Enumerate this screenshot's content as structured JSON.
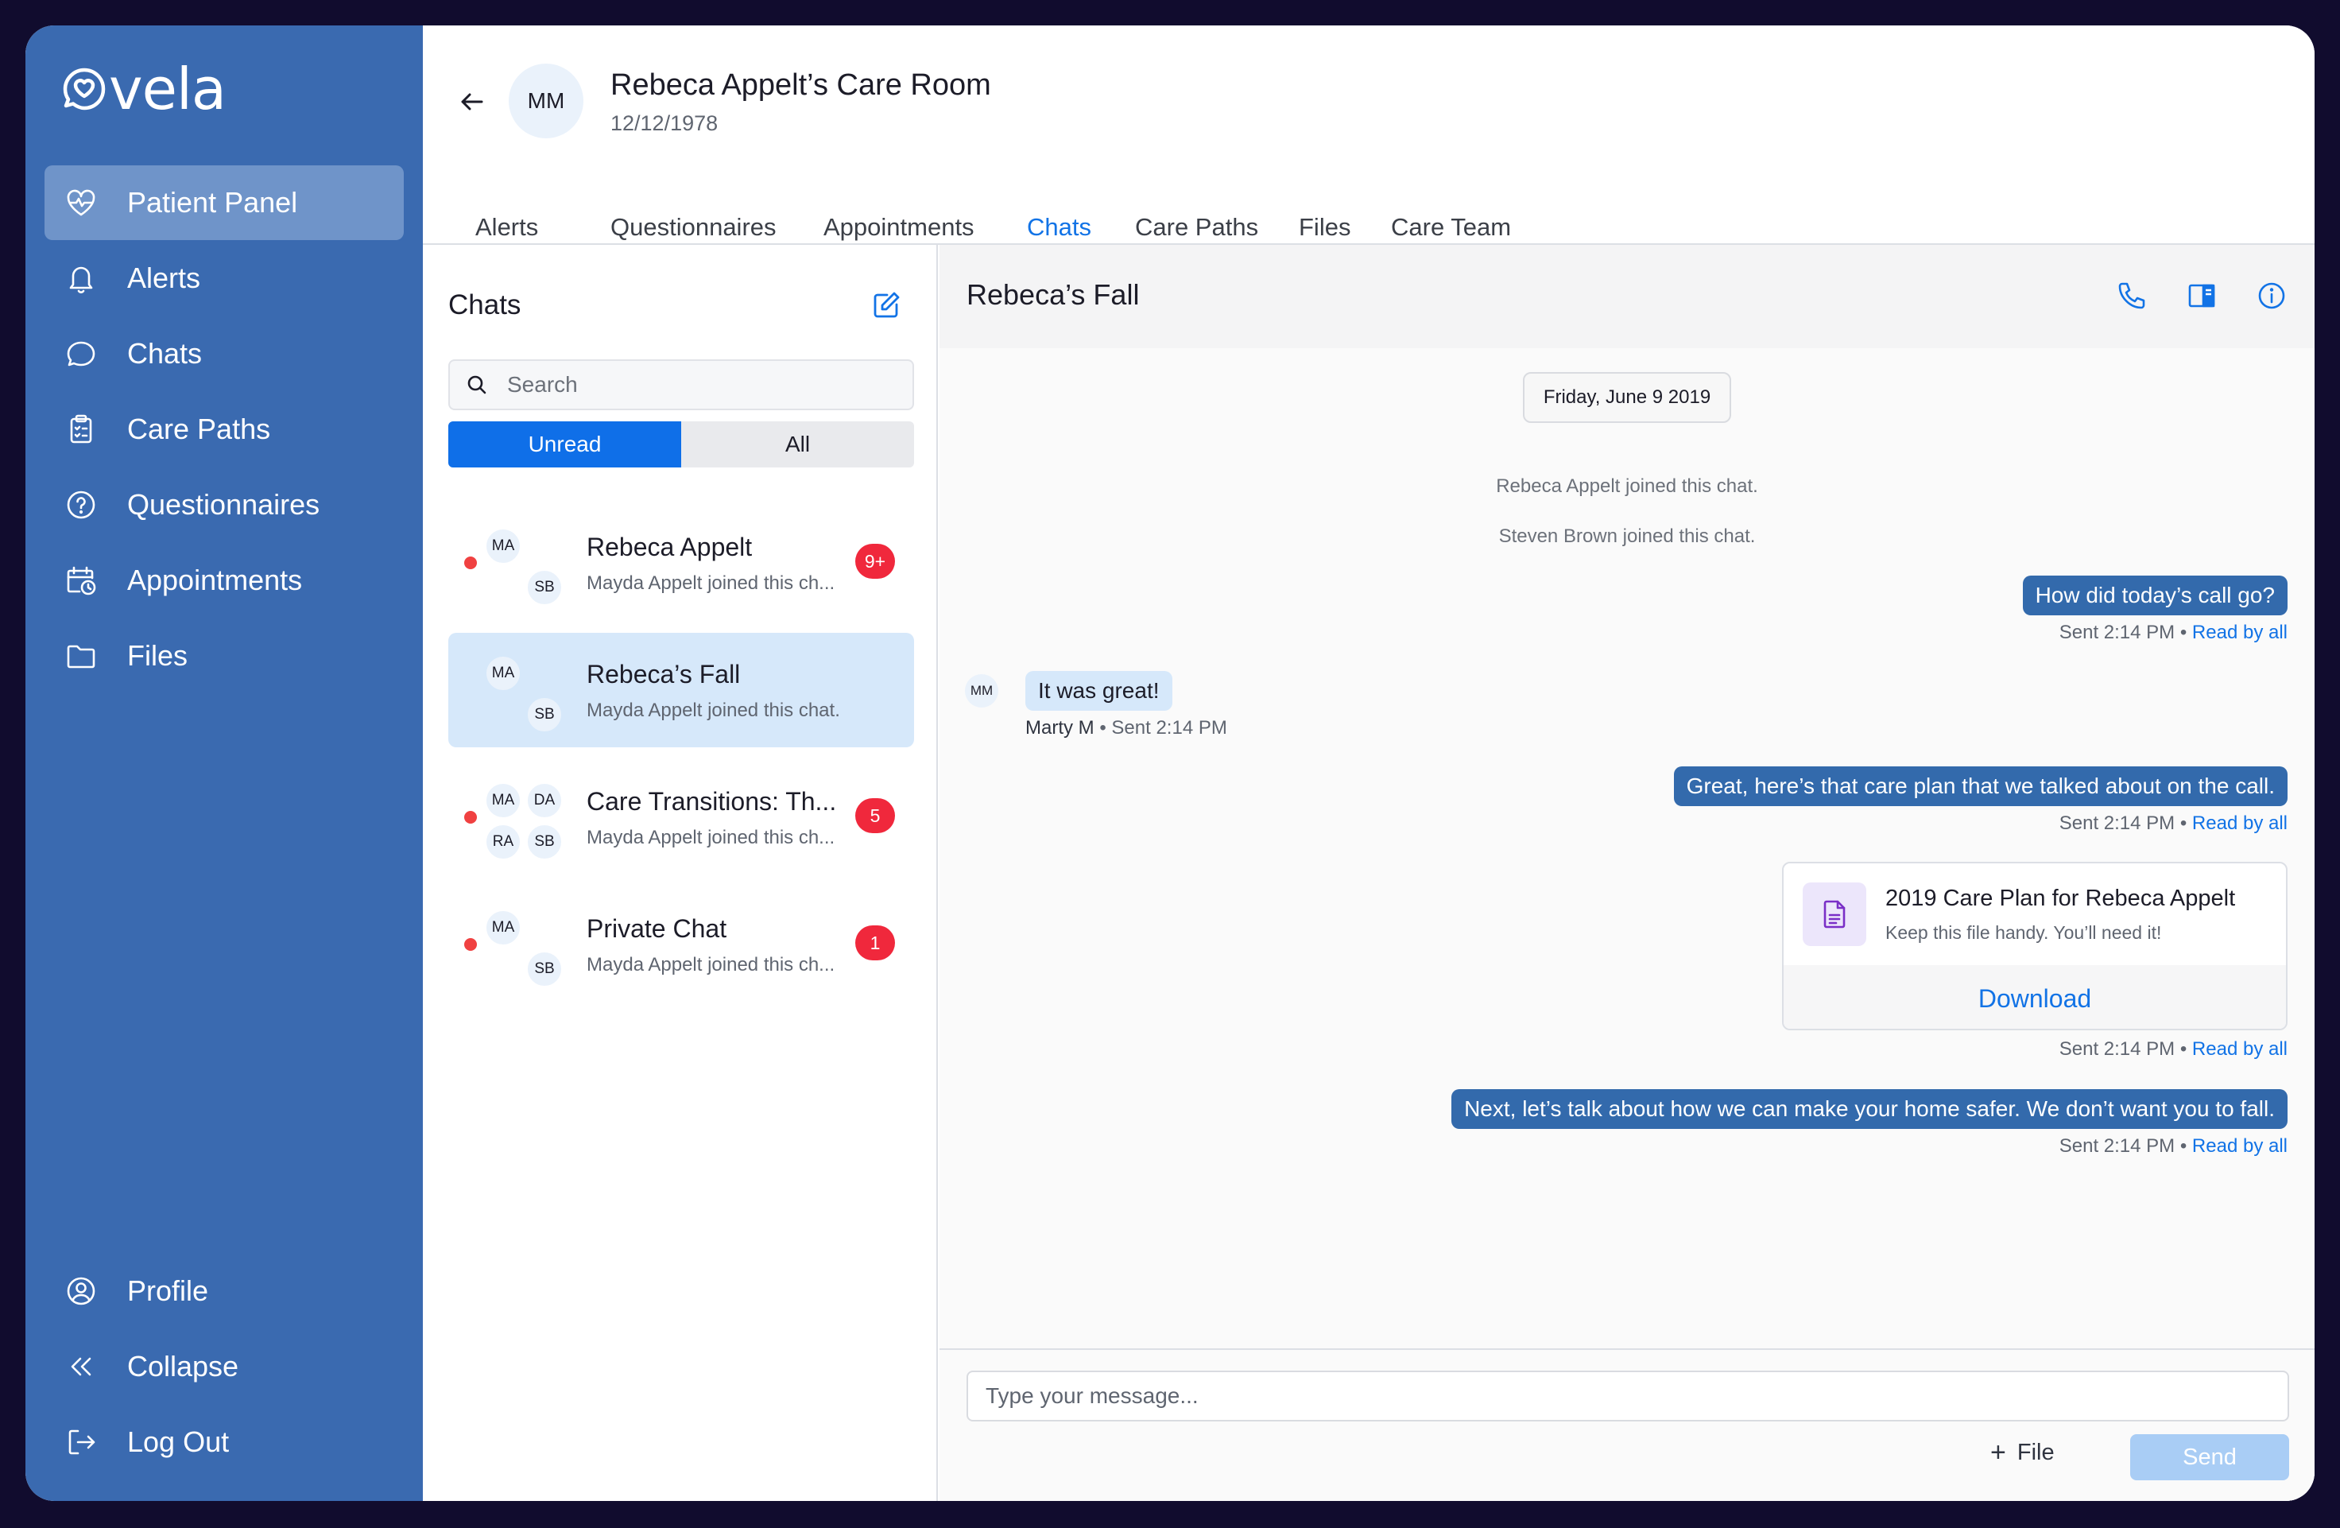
{
  "brand": {
    "name": "vela",
    "logo_icon": "heart-chat-icon"
  },
  "sidebar": {
    "items": [
      {
        "label": "Patient Panel",
        "icon": "heart-pulse-icon",
        "active": true
      },
      {
        "label": "Alerts",
        "icon": "bell-icon"
      },
      {
        "label": "Chats",
        "icon": "chat-bubble-icon"
      },
      {
        "label": "Care Paths",
        "icon": "clipboard-icon"
      },
      {
        "label": "Questionnaires",
        "icon": "question-circle-icon"
      },
      {
        "label": "Appointments",
        "icon": "calendar-clock-icon"
      },
      {
        "label": "Files",
        "icon": "folder-icon"
      }
    ],
    "bottom_items": [
      {
        "label": "Profile",
        "icon": "user-circle-icon"
      },
      {
        "label": "Collapse",
        "icon": "double-chevron-left-icon"
      },
      {
        "label": "Log Out",
        "icon": "logout-icon"
      }
    ]
  },
  "room": {
    "avatar_initials": "MM",
    "title": "Rebeca Appelt’s Care Room",
    "dob": "12/12/1978"
  },
  "tabs": [
    {
      "label": "Alerts"
    },
    {
      "label": "Questionnaires"
    },
    {
      "label": "Appointments"
    },
    {
      "label": "Chats",
      "active": true
    },
    {
      "label": "Care Paths"
    },
    {
      "label": "Files"
    },
    {
      "label": "Care Team"
    }
  ],
  "chat_list": {
    "title": "Chats",
    "search_placeholder": "Search",
    "filter": {
      "unread": "Unread",
      "all": "All",
      "selected": "Unread"
    },
    "conversations": [
      {
        "name": "Rebeca Appelt",
        "preview": "Mayda Appelt joined this ch...",
        "badge": "9+",
        "unread": true,
        "avatars": [
          "MA",
          "SB"
        ]
      },
      {
        "name": "Rebeca’s Fall",
        "preview": "Mayda Appelt joined this chat.",
        "badge": "",
        "unread": false,
        "selected": true,
        "avatars": [
          "MA",
          "SB"
        ]
      },
      {
        "name": "Care Transitions: Th...",
        "preview": "Mayda Appelt joined this ch...",
        "badge": "5",
        "unread": true,
        "avatars": [
          "MA",
          "DA",
          "RA",
          "SB"
        ]
      },
      {
        "name": "Private Chat",
        "preview": "Mayda Appelt joined this ch...",
        "badge": "1",
        "unread": true,
        "avatars": [
          "MA",
          "SB"
        ]
      }
    ]
  },
  "conversation": {
    "title": "Rebeca’s Fall",
    "header_icons": [
      "phone-icon",
      "side-panel-icon",
      "info-icon"
    ],
    "date_divider": "Friday, June 9 2019",
    "system_messages": [
      "Rebeca Appelt joined this chat.",
      "Steven Brown joined this chat."
    ],
    "messages": [
      {
        "direction": "out",
        "text": "How did today’s call go?",
        "sent": "Sent 2:14 PM",
        "read": "Read by all"
      },
      {
        "direction": "in",
        "avatar": "MM",
        "text": "It was great!",
        "sender": "Marty M",
        "sent": "Sent 2:14 PM"
      },
      {
        "direction": "out",
        "text": "Great, here’s that care plan that we talked about on the call.",
        "sent": "Sent 2:14 PM",
        "read": "Read by all"
      },
      {
        "direction": "out",
        "type": "file",
        "file_name": "2019 Care Plan for Rebeca Appelt",
        "file_desc": "Keep this file handy. You’ll need it!",
        "action": "Download",
        "sent": "Sent 2:14 PM",
        "read": "Read by all"
      },
      {
        "direction": "out",
        "text": "Next, let’s talk about how we can make your home safer. We don’t want you to fall.",
        "sent": "Sent 2:14 PM",
        "read": "Read by all"
      }
    ],
    "separator": "•"
  },
  "composer": {
    "placeholder": "Type your message...",
    "file_label": "File",
    "send_label": "Send"
  },
  "colors": {
    "sidebar": "#3a6ab0",
    "sidebar_active": "#6f94c9",
    "accent": "#1273e6",
    "outgoing_bubble": "#336aac",
    "incoming_bubble": "#d6e8fa",
    "badge": "#f0283c",
    "send_disabled": "#a9cdf5"
  }
}
